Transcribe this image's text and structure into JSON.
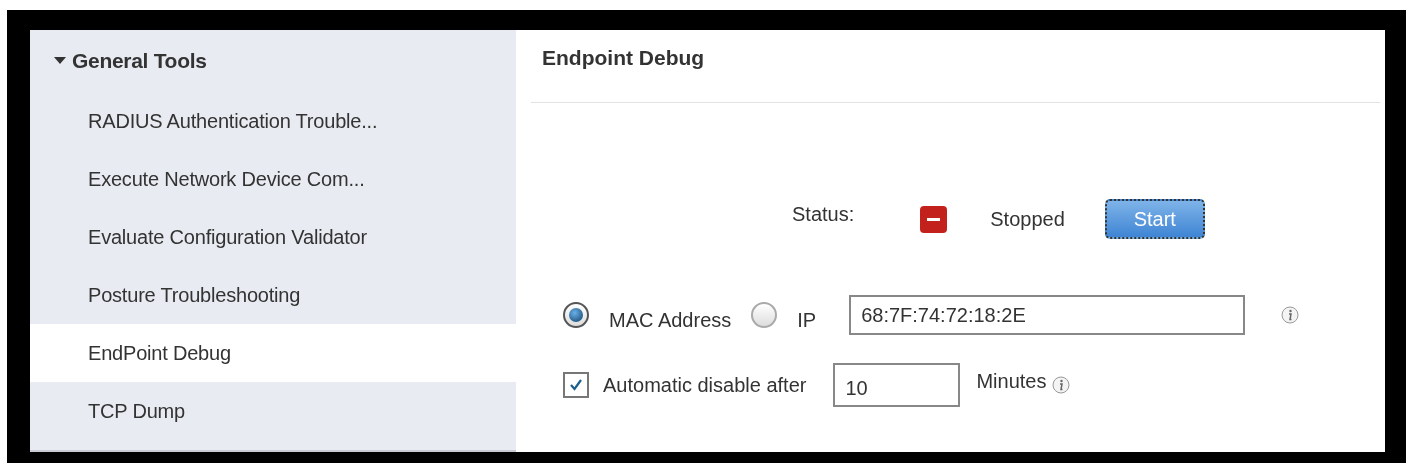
{
  "sidebar": {
    "group": {
      "label": "General Tools",
      "expanded": true
    },
    "items": [
      {
        "label": "RADIUS Authentication Trouble...",
        "selected": false
      },
      {
        "label": "Execute Network Device Com...",
        "selected": false
      },
      {
        "label": "Evaluate Configuration Validator",
        "selected": false
      },
      {
        "label": "Posture Troubleshooting",
        "selected": false
      },
      {
        "label": "EndPoint Debug",
        "selected": true
      },
      {
        "label": "TCP Dump",
        "selected": false
      }
    ]
  },
  "panel": {
    "title": "Endpoint Debug",
    "status": {
      "label": "Status:",
      "running": false,
      "state": "Stopped",
      "button": "Start"
    },
    "address_type": [
      {
        "label": "MAC Address",
        "selected": true
      },
      {
        "label": "IP",
        "selected": false
      }
    ],
    "address": {
      "value": "68:7F:74:72:18:2E"
    },
    "auto_disable": {
      "label": "Automatic disable after",
      "checked": true,
      "value": "10",
      "unit": "Minutes"
    }
  }
}
